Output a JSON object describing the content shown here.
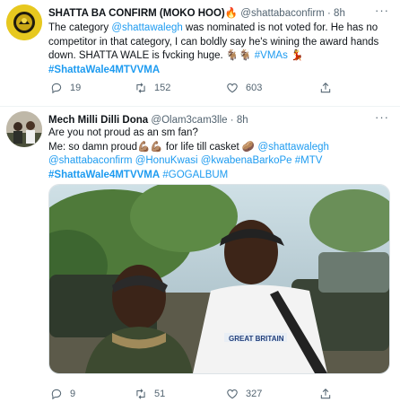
{
  "tweet1": {
    "display_name": "SHATTA BA CONFIRM (MOKO HOO)",
    "fire_emoji": "🔥",
    "handle": "@shattabaconfirm",
    "sep": "·",
    "time": "8h",
    "text_a": "The category ",
    "mention": "@shattawalegh",
    "text_b": " was nominated is not voted for. He has no competitor in that category, I can boldly say he's wining the award hands down. SHATTA WALE is fvcking huge. 🐐🐐 ",
    "hashtag_inline": "#VMAs",
    "emoji_tail": " 💃",
    "hashtag": "#ShattaWale4MTVVMA",
    "replies": "19",
    "retweets": "152",
    "likes": "603"
  },
  "tweet2": {
    "display_name": "Mech Milli Dilli Dona",
    "handle": "@Olam3cam3lle",
    "sep": "·",
    "time": "8h",
    "line1": "Are you not proud as an sm fan?",
    "line2_a": "Me: so damn proud💪🏽💪🏽  for life till casket 🥔 ",
    "mention1": "@shattawalegh",
    "mention2": "@shattabaconfirm",
    "mention3": "@HonuKwasi",
    "mention4": "@kwabenaBarkoPe",
    "hashtag1": "#MTV",
    "hashtag2": "#ShattaWale4MTVVMA",
    "hashtag3": "#GOGALBUM",
    "shirt_text": "GREAT BRITAIN",
    "replies": "9",
    "retweets": "51",
    "likes": "327"
  },
  "more_label": "···",
  "colors": {
    "link": "#1d9bf0",
    "muted": "#536471",
    "divider": "#eff3f4",
    "avatar1": "#d4b716"
  }
}
